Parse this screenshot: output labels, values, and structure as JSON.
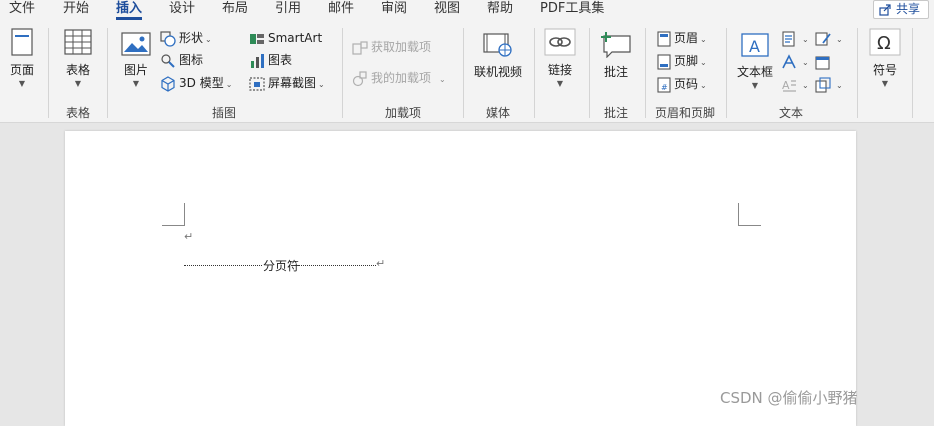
{
  "menu": {
    "tabs": [
      {
        "label": "文件"
      },
      {
        "label": "开始"
      },
      {
        "label": "插入"
      },
      {
        "label": "设计"
      },
      {
        "label": "布局"
      },
      {
        "label": "引用"
      },
      {
        "label": "邮件"
      },
      {
        "label": "审阅"
      },
      {
        "label": "视图"
      },
      {
        "label": "帮助"
      },
      {
        "label": "PDF工具集"
      }
    ],
    "active_tab": "插入",
    "share_label": "共享"
  },
  "ribbon": {
    "pages": {
      "button": "页面",
      "group": ""
    },
    "tables": {
      "button": "表格",
      "group": "表格"
    },
    "illustrations": {
      "group": "插图",
      "pictures": "图片",
      "shapes": "形状",
      "icons": "图标",
      "model3d": "3D 模型",
      "smartart": "SmartArt",
      "chart": "图表",
      "screenshot": "屏幕截图"
    },
    "addins": {
      "group": "加载项",
      "get": "获取加载项",
      "mine": "我的加载项"
    },
    "media": {
      "group": "媒体",
      "video": "联机视频"
    },
    "links": {
      "button": "链接",
      "group": ""
    },
    "comments": {
      "group": "批注",
      "comment": "批注"
    },
    "header_footer": {
      "group": "页眉和页脚",
      "header": "页眉",
      "footer": "页脚",
      "page_number": "页码"
    },
    "text": {
      "group": "文本",
      "textbox": "文本框"
    },
    "symbols": {
      "button": "符号",
      "group": ""
    }
  },
  "document": {
    "page_break_label": "分页符",
    "paragraph_mark": "↵"
  },
  "watermark": "CSDN @偷偷小野猪",
  "colors": {
    "accent": "#1e4e9c",
    "ribbon_bg": "#f3f3f3",
    "workspace_bg": "#e6e6e6"
  }
}
